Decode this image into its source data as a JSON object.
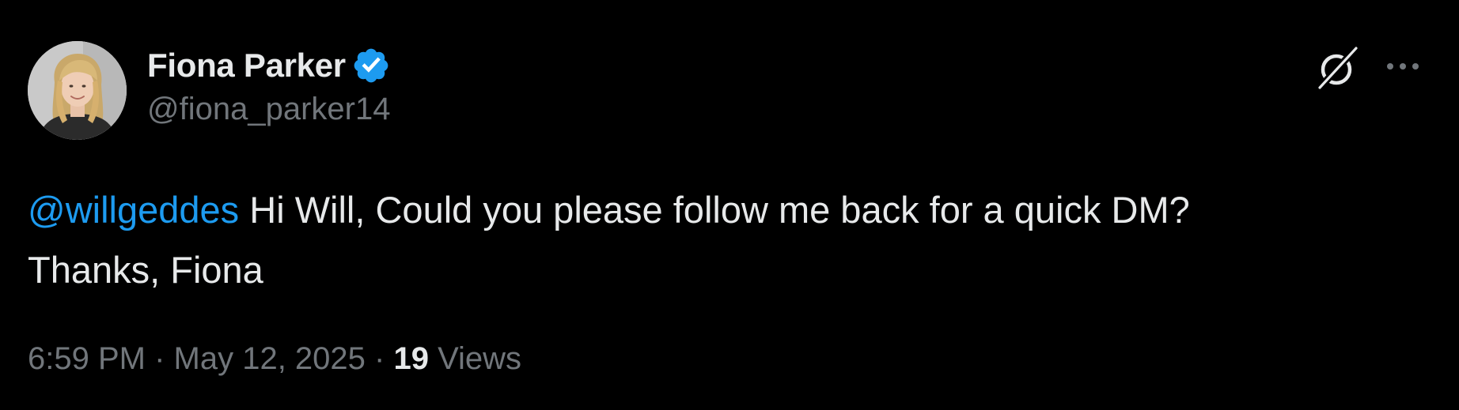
{
  "author": {
    "display_name": "Fiona Parker",
    "handle": "@fiona_parker14",
    "verified": true,
    "avatar_icon": "profile-photo"
  },
  "actions": {
    "grok_icon": "grok-icon",
    "more_icon": "more-dots-icon"
  },
  "tweet": {
    "mention": "@willgeddes",
    "text_after_mention": " Hi Will, Could you please follow me back for a quick DM?\nThanks, Fiona"
  },
  "meta": {
    "time": "6:59 PM",
    "separator1": " · ",
    "date": "May 12, 2025",
    "separator2": " · ",
    "views_count": "19",
    "views_label": " Views"
  },
  "colors": {
    "background": "#000000",
    "primary_text": "#e7e9ea",
    "secondary_text": "#71767b",
    "accent": "#1d9bf0"
  }
}
